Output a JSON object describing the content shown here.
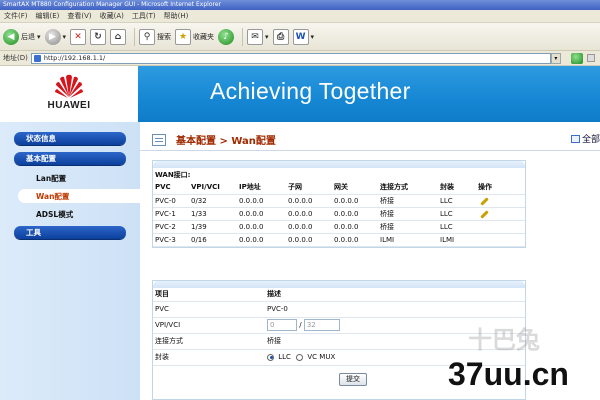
{
  "window": {
    "title": "SmartAX MT880 Configuration Manager GUI - Microsoft Internet Explorer"
  },
  "menu": [
    "文件(F)",
    "编辑(E)",
    "查看(V)",
    "收藏(A)",
    "工具(T)",
    "帮助(H)"
  ],
  "toolbar": {
    "back_label": "后退",
    "search_label": "搜索",
    "favorites_label": "收藏夹"
  },
  "address": {
    "label": "地址(D)",
    "url": "http://192.168.1.1/"
  },
  "banner": {
    "logo_text": "HUAWEI",
    "slogan": "Achieving Together"
  },
  "sidebar": {
    "status": "状态信息",
    "basic": "基本配置",
    "lan": "Lan配置",
    "wan": "Wan配置",
    "adsl": "ADSL模式",
    "tools": "工具"
  },
  "breadcrumb": "基本配置 > Wan配置",
  "expand_all": "全部",
  "wan_table": {
    "caption": "WAN接口:",
    "headers": [
      "PVC",
      "VPI/VCI",
      "IP地址",
      "子网",
      "网关",
      "连接方式",
      "封装",
      "操作"
    ],
    "rows": [
      [
        "PVC-0",
        "0/32",
        "0.0.0.0",
        "0.0.0.0",
        "0.0.0.0",
        "桥接",
        "LLC",
        "edit"
      ],
      [
        "PVC-1",
        "1/33",
        "0.0.0.0",
        "0.0.0.0",
        "0.0.0.0",
        "桥接",
        "LLC",
        "edit"
      ],
      [
        "PVC-2",
        "1/39",
        "0.0.0.0",
        "0.0.0.0",
        "0.0.0.0",
        "桥接",
        "LLC",
        ""
      ],
      [
        "PVC-3",
        "0/16",
        "0.0.0.0",
        "0.0.0.0",
        "0.0.0.0",
        "ILMI",
        "ILMI",
        ""
      ]
    ]
  },
  "detail": {
    "header_item": "项目",
    "header_desc": "描述",
    "pvc_label": "PVC",
    "pvc_value": "PVC-0",
    "vpivci_label": "VPI/VCI",
    "vpi_value": "0",
    "slash": "/",
    "vci_value": "32",
    "conn_label": "连接方式",
    "conn_value": "桥接",
    "encap_label": "封装",
    "encap_options": [
      "LLC",
      "VC MUX"
    ],
    "encap_selected": "LLC",
    "submit_label": "提交"
  },
  "watermark": {
    "text": "37uu.cn",
    "faint": "十巴兔"
  },
  "colors": {
    "banner_blue": "#1687d4",
    "nav_blue": "#0b3f9c",
    "active_text": "#c03a00",
    "sidebar_bg": "#dcebfa"
  }
}
